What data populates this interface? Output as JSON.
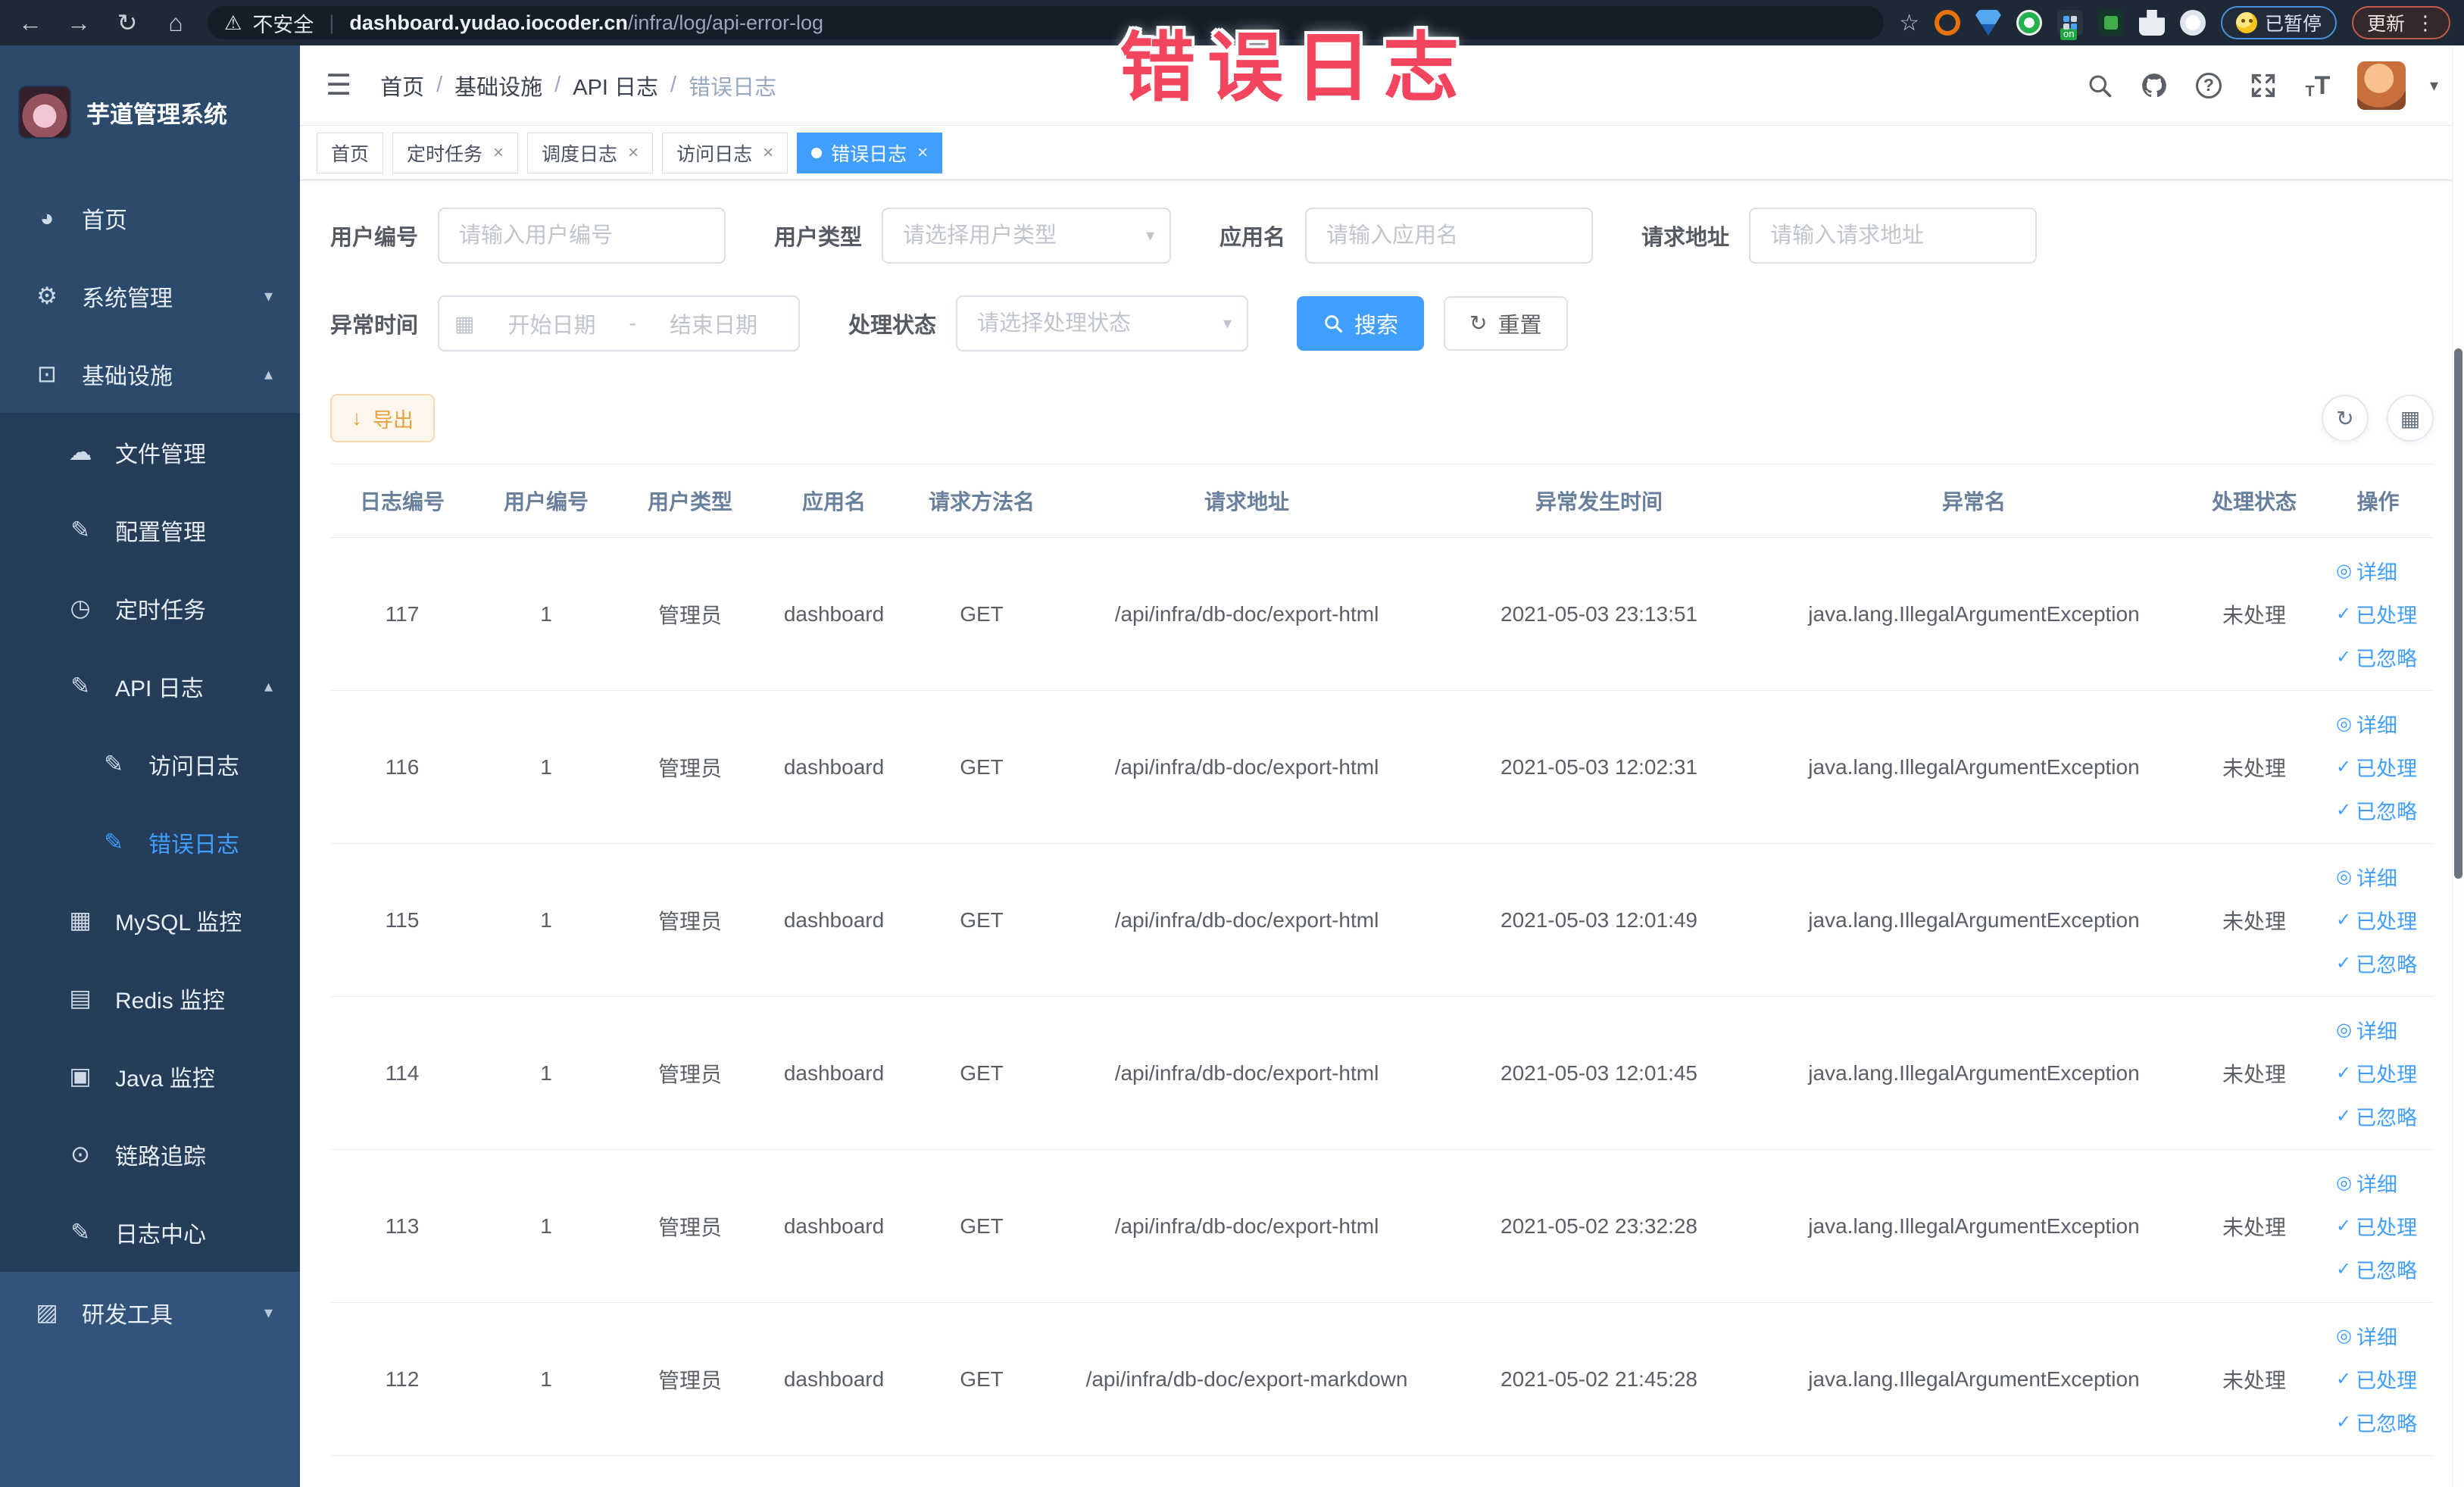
{
  "colors": {
    "accent": "#409eff",
    "warning": "#e6a23c",
    "overlay": "#f3455e",
    "sidebar_bg": "#2c4a6b",
    "chrome_bg": "#1d2935"
  },
  "browser": {
    "security_label": "不安全",
    "url_domain": "dashboard.yudao.iocoder.cn",
    "url_path": "/infra/log/api-error-log",
    "paused_label": "已暂停",
    "update_label": "更新"
  },
  "overlay_title": "错误日志",
  "sidebar": {
    "logo_text": "芋道管理系统",
    "menu": [
      {
        "label": "首页",
        "icon": "◕"
      },
      {
        "label": "系统管理",
        "icon": "⚙"
      },
      {
        "label": "基础设施",
        "icon": "⊡"
      },
      {
        "label": "文件管理",
        "icon": "☁"
      },
      {
        "label": "配置管理",
        "icon": "✎"
      },
      {
        "label": "定时任务",
        "icon": "◷"
      },
      {
        "label": "API 日志",
        "icon": "✎"
      },
      {
        "label": "访问日志",
        "icon": "✎"
      },
      {
        "label": "错误日志",
        "icon": "✎"
      },
      {
        "label": "MySQL 监控",
        "icon": "▦"
      },
      {
        "label": "Redis 监控",
        "icon": "▤"
      },
      {
        "label": "Java 监控",
        "icon": "▣"
      },
      {
        "label": "链路追踪",
        "icon": "⊙"
      },
      {
        "label": "日志中心",
        "icon": "✎"
      },
      {
        "label": "研发工具",
        "icon": "▨"
      }
    ]
  },
  "breadcrumb": {
    "items": [
      "首页",
      "基础设施",
      "API 日志",
      "错误日志"
    ]
  },
  "tabs": [
    {
      "label": "首页"
    },
    {
      "label": "定时任务"
    },
    {
      "label": "调度日志"
    },
    {
      "label": "访问日志"
    },
    {
      "label": "错误日志"
    }
  ],
  "filters": {
    "user_id": {
      "label": "用户编号",
      "placeholder": "请输入用户编号"
    },
    "user_type": {
      "label": "用户类型",
      "placeholder": "请选择用户类型"
    },
    "app_name": {
      "label": "应用名",
      "placeholder": "请输入应用名"
    },
    "request_url": {
      "label": "请求地址",
      "placeholder": "请输入请求地址"
    },
    "exception_time": {
      "label": "异常时间",
      "start_placeholder": "开始日期",
      "separator": "-",
      "end_placeholder": "结束日期"
    },
    "process_status": {
      "label": "处理状态",
      "placeholder": "请选择处理状态"
    },
    "search_label": "搜索",
    "reset_label": "重置"
  },
  "toolbar": {
    "export_label": "导出"
  },
  "table": {
    "columns": [
      "日志编号",
      "用户编号",
      "用户类型",
      "应用名",
      "请求方法名",
      "请求地址",
      "异常发生时间",
      "异常名",
      "处理状态",
      "操作"
    ],
    "action_labels": {
      "detail": "详细",
      "processed": "已处理",
      "ignore": "已忽略"
    },
    "rows": [
      {
        "id": "117",
        "user_id": "1",
        "user_type": "管理员",
        "app": "dashboard",
        "method": "GET",
        "url": "/api/infra/db-doc/export-html",
        "time": "2021-05-03 23:13:51",
        "exception": "java.lang.IllegalArgumentException",
        "status": "未处理"
      },
      {
        "id": "116",
        "user_id": "1",
        "user_type": "管理员",
        "app": "dashboard",
        "method": "GET",
        "url": "/api/infra/db-doc/export-html",
        "time": "2021-05-03 12:02:31",
        "exception": "java.lang.IllegalArgumentException",
        "status": "未处理"
      },
      {
        "id": "115",
        "user_id": "1",
        "user_type": "管理员",
        "app": "dashboard",
        "method": "GET",
        "url": "/api/infra/db-doc/export-html",
        "time": "2021-05-03 12:01:49",
        "exception": "java.lang.IllegalArgumentException",
        "status": "未处理"
      },
      {
        "id": "114",
        "user_id": "1",
        "user_type": "管理员",
        "app": "dashboard",
        "method": "GET",
        "url": "/api/infra/db-doc/export-html",
        "time": "2021-05-03 12:01:45",
        "exception": "java.lang.IllegalArgumentException",
        "status": "未处理"
      },
      {
        "id": "113",
        "user_id": "1",
        "user_type": "管理员",
        "app": "dashboard",
        "method": "GET",
        "url": "/api/infra/db-doc/export-html",
        "time": "2021-05-02 23:32:28",
        "exception": "java.lang.IllegalArgumentException",
        "status": "未处理"
      },
      {
        "id": "112",
        "user_id": "1",
        "user_type": "管理员",
        "app": "dashboard",
        "method": "GET",
        "url": "/api/infra/db-doc/export-markdown",
        "time": "2021-05-02 21:45:28",
        "exception": "java.lang.IllegalArgumentException",
        "status": "未处理"
      }
    ]
  }
}
